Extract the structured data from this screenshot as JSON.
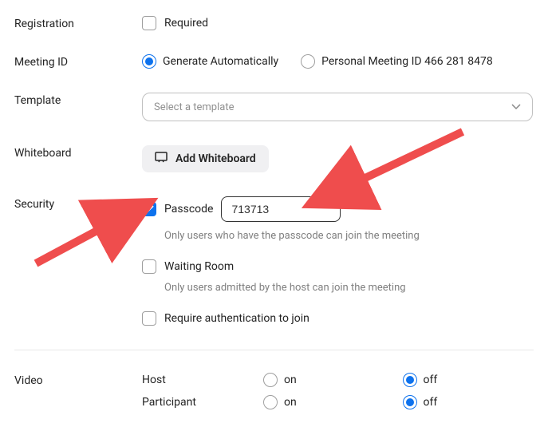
{
  "registration": {
    "label": "Registration",
    "required_label": "Required",
    "required_checked": false
  },
  "meeting_id": {
    "label": "Meeting ID",
    "auto_label": "Generate Automatically",
    "pmi_label": "Personal Meeting ID 466 281 8478",
    "selected": "auto"
  },
  "template": {
    "label": "Template",
    "placeholder": "Select a template"
  },
  "whiteboard": {
    "label": "Whiteboard",
    "button_label": "Add Whiteboard"
  },
  "security": {
    "label": "Security",
    "passcode_label": "Passcode",
    "passcode_checked": true,
    "passcode_value": "713713",
    "passcode_hint": "Only users who have the passcode can join the meeting",
    "waiting_label": "Waiting Room",
    "waiting_checked": false,
    "waiting_hint": "Only users admitted by the host can join the meeting",
    "auth_label": "Require authentication to join",
    "auth_checked": false
  },
  "video": {
    "label": "Video",
    "host_label": "Host",
    "participant_label": "Participant",
    "on_label": "on",
    "off_label": "off",
    "host_value": "off",
    "participant_value": "off"
  }
}
